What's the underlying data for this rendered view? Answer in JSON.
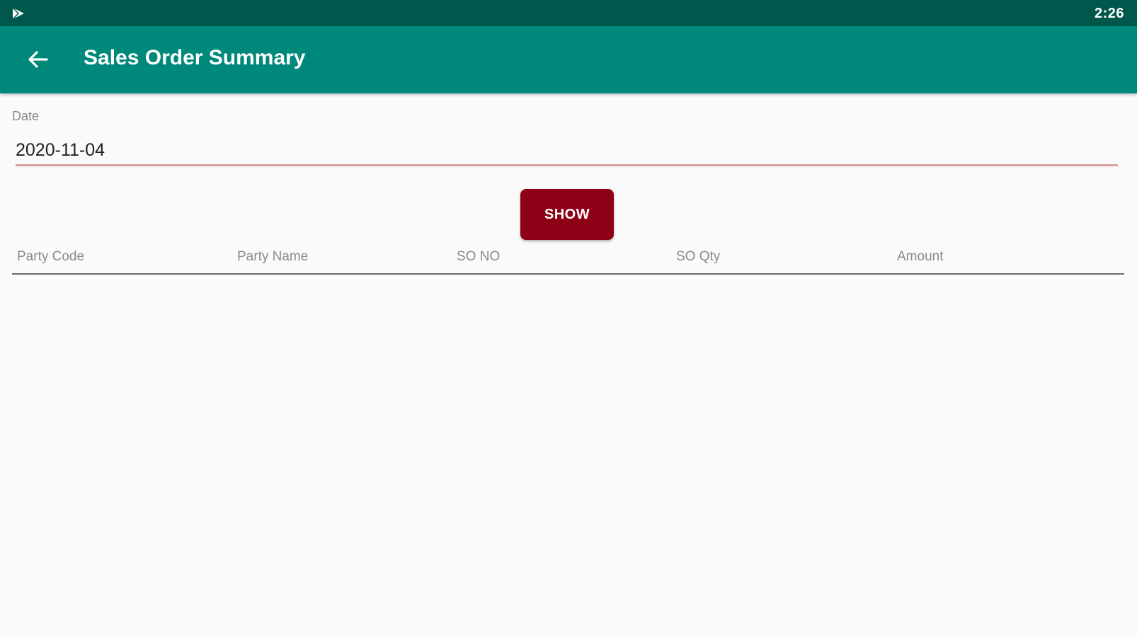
{
  "status_bar": {
    "time": "2:26",
    "left_icon": "play-store-icon"
  },
  "app_bar": {
    "back_icon": "arrow-back-icon",
    "title": "Sales Order Summary"
  },
  "form": {
    "date_label": "Date",
    "date_value": "2020-11-04",
    "show_button_label": "SHOW"
  },
  "table": {
    "columns": [
      "Party Code",
      "Party Name",
      "SO NO",
      "SO Qty",
      "Amount"
    ],
    "rows": []
  },
  "colors": {
    "status_bar": "#00574b",
    "app_bar": "#00897b",
    "show_button": "#8e0015",
    "input_underline": "#d8a0a0",
    "background": "#fafafa"
  }
}
